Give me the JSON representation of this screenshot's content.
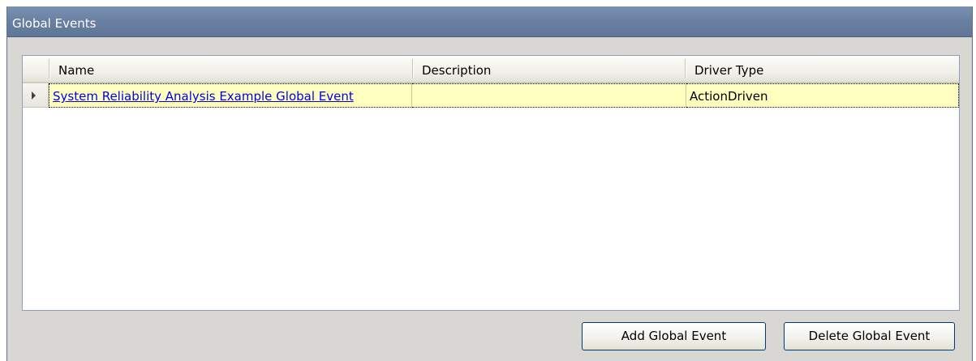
{
  "panel": {
    "title": "Global Events"
  },
  "grid": {
    "columns": [
      "Name",
      "Description",
      "Driver Type"
    ],
    "rows": [
      {
        "name": "System Reliability Analysis Example Global Event",
        "description": "",
        "driver_type": "ActionDriven"
      }
    ]
  },
  "buttons": {
    "add_label": "Add Global Event",
    "delete_label": "Delete Global Event"
  },
  "colors": {
    "title_bar": "#6a81a3",
    "selected_row": "#ffffc0",
    "link": "#0000ee",
    "panel_bg": "#d8d7d3"
  }
}
